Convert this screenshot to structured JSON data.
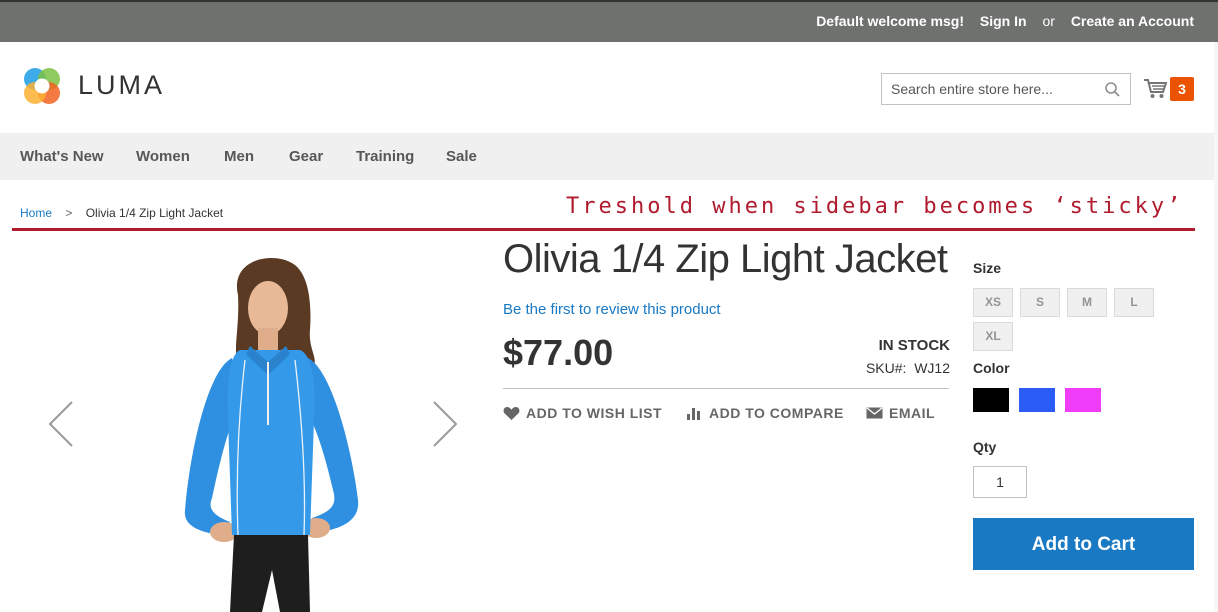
{
  "topbar": {
    "welcome": "Default welcome msg!",
    "sign_in": "Sign In",
    "or": "or",
    "create_account": "Create an Account"
  },
  "header": {
    "logo_text": "LUMA",
    "search_placeholder": "Search entire store here...",
    "cart_count": "3"
  },
  "nav": {
    "items": [
      "What's New",
      "Women",
      "Men",
      "Gear",
      "Training",
      "Sale"
    ]
  },
  "breadcrumb": {
    "home": "Home",
    "separator": ">",
    "current": "Olivia 1/4 Zip Light Jacket"
  },
  "annotation": {
    "text": "Treshold when sidebar becomes ‘sticky’",
    "color": "#b01b2e"
  },
  "product": {
    "title": "Olivia 1/4 Zip Light Jacket",
    "review_link": "Be the first to review this product",
    "price": "$77.00",
    "stock": "IN STOCK",
    "sku_label": "SKU#:",
    "sku_value": "WJ12",
    "actions": {
      "wishlist": "ADD TO WISH LIST",
      "compare": "ADD TO COMPARE",
      "email": "EMAIL"
    }
  },
  "options": {
    "size_label": "Size",
    "sizes": [
      "XS",
      "S",
      "M",
      "L",
      "XL"
    ],
    "color_label": "Color",
    "colors": [
      "#000000",
      "#2b5cf5",
      "#ef3dfa"
    ],
    "qty_label": "Qty",
    "qty_value": "1",
    "add_to_cart": "Add to Cart"
  },
  "colors": {
    "accent": "#1979c3",
    "badge": "#eb5202",
    "topbar": "#6e716e",
    "nav_bg": "#f0f0f0"
  }
}
